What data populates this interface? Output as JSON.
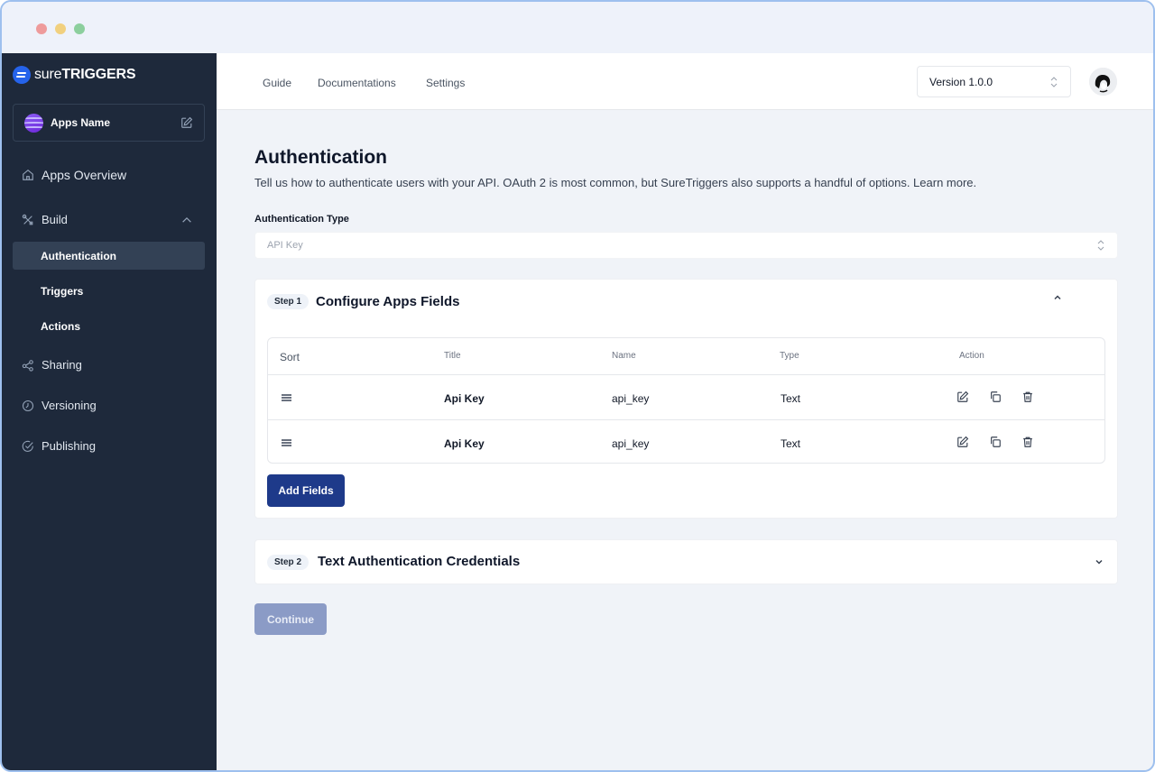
{
  "window": {
    "controls": [
      "close",
      "minimize",
      "maximize"
    ]
  },
  "sidebar": {
    "logo": {
      "light": "sure",
      "bold": "TRIGGERS"
    },
    "app_name": "Apps Name",
    "items": [
      {
        "label": "Apps Overview",
        "icon": "home-icon"
      },
      {
        "label": "Build",
        "icon": "tools-icon",
        "expanded": true,
        "children": [
          {
            "label": "Authentication",
            "active": true
          },
          {
            "label": "Triggers"
          },
          {
            "label": "Actions"
          }
        ]
      },
      {
        "label": "Sharing",
        "icon": "share-icon"
      },
      {
        "label": "Versioning",
        "icon": "clock-icon"
      },
      {
        "label": "Publishing",
        "icon": "check-circle-icon"
      }
    ]
  },
  "topbar": {
    "links": [
      "Guide",
      "Documentations",
      "Settings"
    ],
    "version_select": {
      "value": "Version 1.0.0"
    }
  },
  "main": {
    "title": "Authentication",
    "description": "Tell us how to authenticate users with your API. OAuth 2 is most common, but SureTriggers also supports a handful of options. Learn more.",
    "auth_type": {
      "label": "Authentication Type",
      "placeholder": "API Key"
    },
    "step1": {
      "badge": "Step 1",
      "title": "Configure Apps Fields",
      "expanded": true,
      "table": {
        "columns": [
          "Sort",
          "Title",
          "Name",
          "Type",
          "Action"
        ],
        "rows": [
          {
            "title": "Api Key",
            "name": "api_key",
            "type": "Text"
          },
          {
            "title": "Api Key",
            "name": "api_key",
            "type": "Text"
          }
        ]
      },
      "add_button": "Add Fields"
    },
    "step2": {
      "badge": "Step 2",
      "title": "Text Authentication Credentials",
      "expanded": false
    },
    "continue_button": "Continue"
  },
  "colors": {
    "sidebar_bg": "#1e293b",
    "primary": "#1e3a8a",
    "disabled_button": "#8b9bc6",
    "page_bg": "#f0f3f8"
  }
}
